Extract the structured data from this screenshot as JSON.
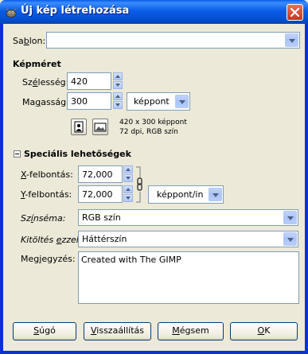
{
  "window": {
    "title": "Új kép létrehozása"
  },
  "template": {
    "label": "Sablon:",
    "value": ""
  },
  "image_size": {
    "heading": "Képméret",
    "width_label": "Szélesség:",
    "width_value": "420",
    "height_label": "Magasság:",
    "height_value": "300",
    "unit_value": "képpont",
    "info_line1": "420 x 300 képpont",
    "info_line2": "72 dpi, RGB szín"
  },
  "advanced": {
    "heading": "Speciális lehetőségek",
    "xres_label": "X-felbontás:",
    "xres_value": "72,000",
    "yres_label": "Y-felbontás:",
    "yres_value": "72,000",
    "res_unit_value": "képpont/in",
    "colorspace_label": "Színséma:",
    "colorspace_value": "RGB szín",
    "fill_label": "Kitöltés ezzel:",
    "fill_value": "Háttérszín",
    "comment_label": "Megjegyzés:",
    "comment_value": "Created with The GIMP"
  },
  "buttons": {
    "help": "Súgó",
    "reset": "Visszaállítás",
    "cancel": "Mégsem",
    "ok": "OK"
  },
  "colors": {
    "titlebar": "#0b5ce5",
    "dialog_bg": "#ece9d8",
    "input_border": "#7f9db9"
  }
}
